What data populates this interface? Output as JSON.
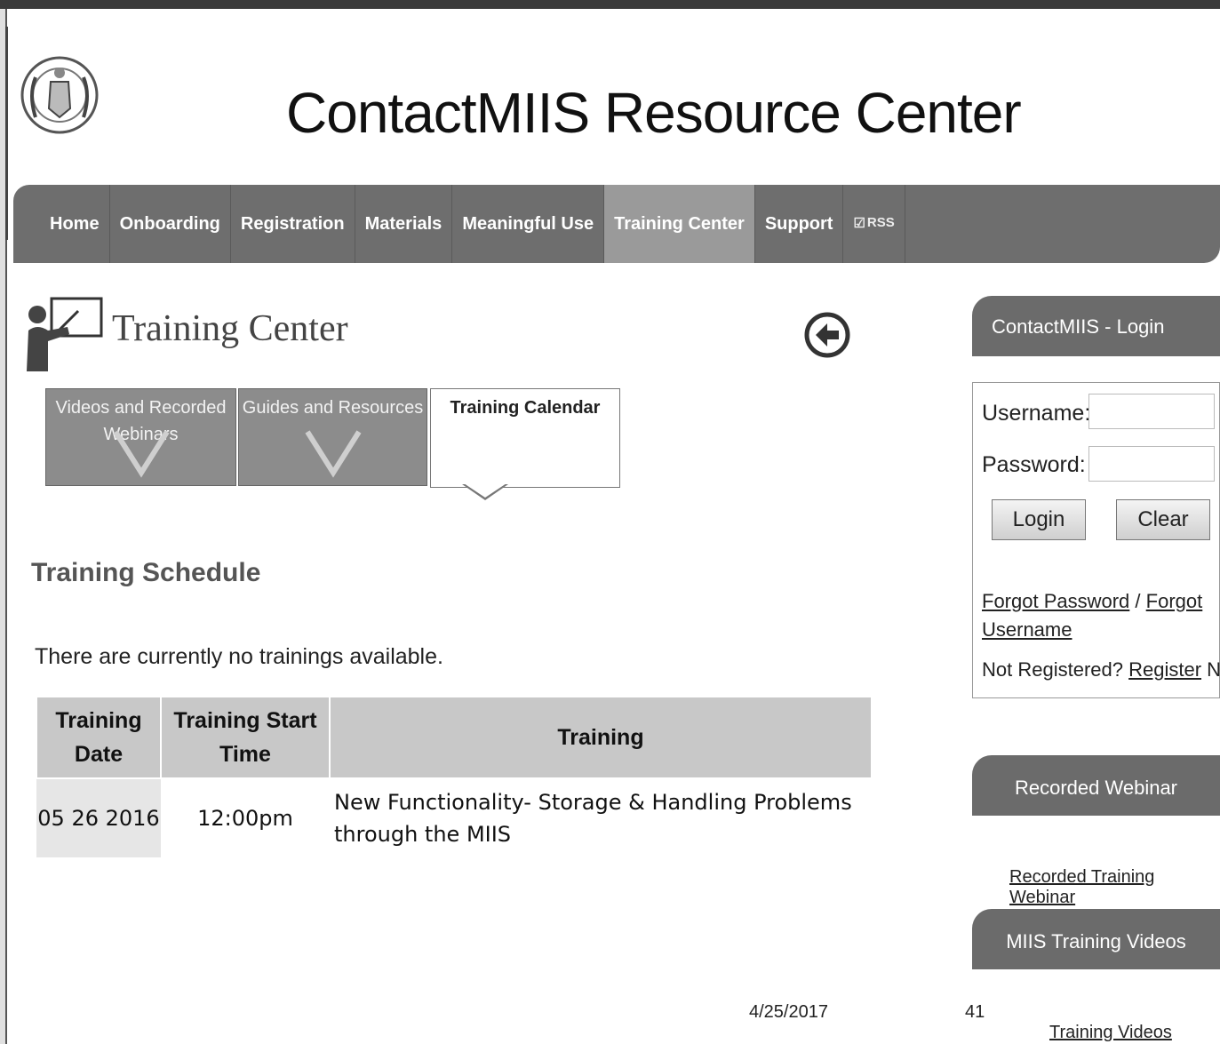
{
  "header": {
    "site_title": "ContactMIIS Resource Center"
  },
  "nav": {
    "items": [
      {
        "label": "Home"
      },
      {
        "label": "Onboarding"
      },
      {
        "label": "Registration"
      },
      {
        "label": "Materials"
      },
      {
        "label": "Meaningful Use"
      },
      {
        "label": "Training Center",
        "active": true
      },
      {
        "label": "Support"
      },
      {
        "label": "RSS",
        "icon": "rss-icon"
      }
    ]
  },
  "page": {
    "title": "Training Center",
    "back_icon": "back-arrow-icon",
    "subtabs": [
      {
        "label": "Videos and Recorded Webinars"
      },
      {
        "label": "Guides and Resources"
      },
      {
        "label": "Training Calendar",
        "active": true
      }
    ],
    "schedule_title": "Training Schedule",
    "no_trainings": "There are currently no trainings available.",
    "table": {
      "headers": [
        "Training Date",
        "Training Start Time",
        "Training"
      ],
      "rows": [
        {
          "date": "05 26 2016",
          "time": "12:00pm",
          "training": "New Functionality- Storage & Handling Problems through the MIIS"
        }
      ]
    }
  },
  "sidebar": {
    "login": {
      "header": "ContactMIIS - Login",
      "username_label": "Username:",
      "password_label": "Password:",
      "username_value": "",
      "password_value": "",
      "login_button": "Login",
      "clear_button": "Clear",
      "forgot_password": "Forgot Password",
      "separator": "/",
      "forgot_username": "Forgot Username",
      "not_registered": "Not Registered?",
      "register": "Register",
      "now": "Now."
    },
    "recorded_webinar": {
      "header": "Recorded Webinar",
      "link": "Recorded Training Webinar"
    },
    "training_videos": {
      "header": "MIIS Training Videos",
      "link": "Training Videos"
    }
  },
  "footer": {
    "date": "4/25/2017",
    "slide_number": "41"
  }
}
